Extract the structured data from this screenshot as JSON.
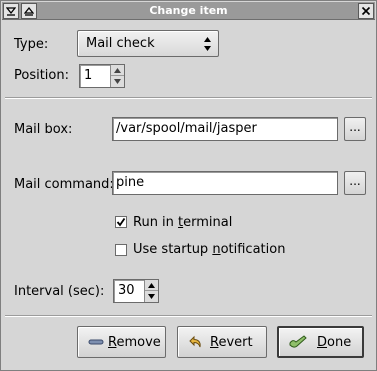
{
  "window": {
    "title": "Change item"
  },
  "form": {
    "type_label": "Type:",
    "type_value": "Mail check",
    "position_label": "Position:",
    "position_value": "1",
    "mailbox_label": "Mail box:",
    "mailbox_value": "/var/spool/mail/jasper",
    "mailbox_browse": "...",
    "command_label": "Mail command:",
    "command_value": "pine",
    "command_browse": "...",
    "run_terminal_pre": "Run in ",
    "run_terminal_u": "t",
    "run_terminal_post": "erminal",
    "run_terminal_checked": true,
    "startup_pre": "Use startup ",
    "startup_u": "n",
    "startup_post": "otification",
    "startup_checked": false,
    "interval_label": "Interval (sec):",
    "interval_value": "30"
  },
  "buttons": {
    "remove_u": "R",
    "remove_rest": "emove",
    "revert_u": "R",
    "revert_rest": "evert",
    "done_u": "D",
    "done_rest": "one"
  },
  "icons": {
    "titlebar_left": [
      "menu-down-icon",
      "shade-up-icon"
    ],
    "titlebar_right": "close-icon",
    "remove": "minus-icon",
    "revert": "undo-arrow-icon",
    "done": "check-hand-icon"
  }
}
